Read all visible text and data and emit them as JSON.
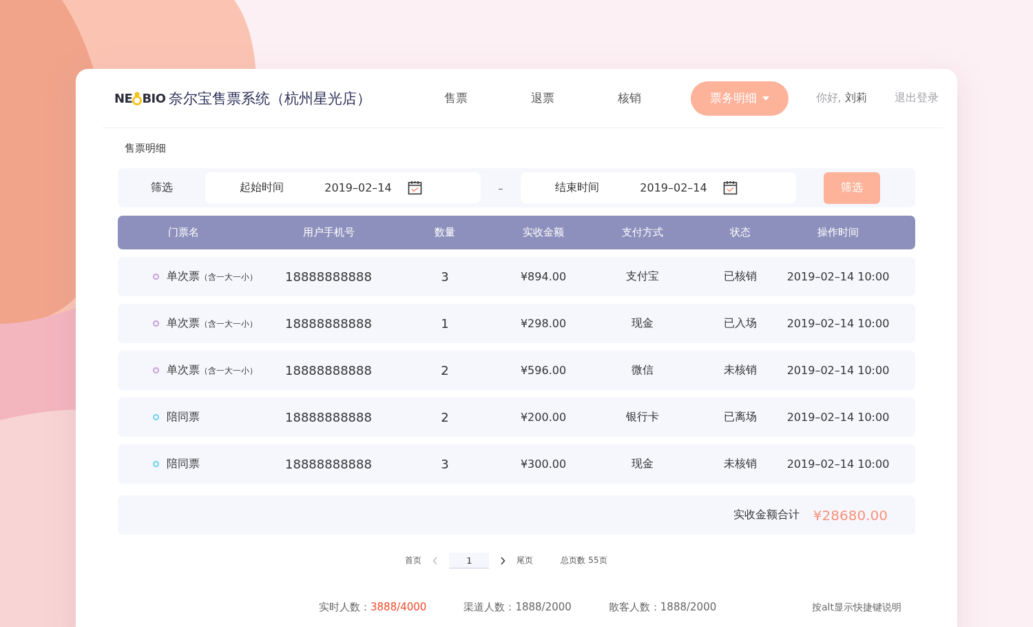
{
  "header": {
    "logo": {
      "left": "NE",
      "right": "BIO"
    },
    "title": "奈尔宝售票系统（杭州星光店）",
    "nav": [
      {
        "label": "售票",
        "selected": false
      },
      {
        "label": "退票",
        "selected": false
      },
      {
        "label": "核销",
        "selected": false
      },
      {
        "label": "票务明细",
        "selected": true
      }
    ],
    "greeting": "你好, **刘莉**",
    "logout": "退出登录"
  },
  "section_title": "售票明细",
  "filter": {
    "label": "筛选",
    "start": {
      "label": "起始时间",
      "value": "2019–02–14"
    },
    "separator": "–",
    "end": {
      "label": "结束时间",
      "value": "2019–02–14"
    },
    "button": "筛选"
  },
  "table": {
    "columns": [
      "门票名",
      "用户手机号",
      "数量",
      "实收金额",
      "支付方式",
      "状态",
      "操作时间"
    ],
    "rows": [
      {
        "name": "单次票",
        "note": "（含一大一小）",
        "color": "#c9a0d8",
        "phone": "18888888888",
        "qty": "3",
        "amount": "¥894.00",
        "payment": "支付宝",
        "status": "已核销",
        "time": "2019–02–14 10:00"
      },
      {
        "name": "单次票",
        "note": "（含一大一小）",
        "color": "#c9a0d8",
        "phone": "18888888888",
        "qty": "1",
        "amount": "¥298.00",
        "payment": "现金",
        "status": "已入场",
        "time": "2019–02–14 10:00"
      },
      {
        "name": "单次票",
        "note": "（含一大一小）",
        "color": "#c9a0d8",
        "phone": "18888888888",
        "qty": "2",
        "amount": "¥596.00",
        "payment": "微信",
        "status": "未核销",
        "time": "2019–02–14 10:00"
      },
      {
        "name": "陪同票",
        "color": "#6dd3f0",
        "phone": "18888888888",
        "qty": "2",
        "amount": "¥200.00",
        "payment": "银行卡",
        "status": "已离场",
        "time": "2019–02–14 10:00"
      },
      {
        "name": "陪同票",
        "color": "#6dd3f0",
        "phone": "18888888888",
        "qty": "3",
        "amount": "¥300.00",
        "payment": "现金",
        "status": "未核销",
        "time": "2019–02–14 10:00"
      }
    ],
    "total": {
      "label": "实收金额合计",
      "value": "¥28680.00"
    }
  },
  "pagination": {
    "first": "首页",
    "page": "1",
    "last": "尾页",
    "total": "总页数 55页"
  },
  "footer": {
    "stats": [
      {
        "label": "实时人数：",
        "value": "3888/4000",
        "highlight": true
      },
      {
        "label": "渠道人数：",
        "value": "1888/2000",
        "highlight": false
      },
      {
        "label": "散客人数：",
        "value": "1888/2000",
        "highlight": false
      }
    ],
    "hint": "按alt显示快捷键说明"
  }
}
